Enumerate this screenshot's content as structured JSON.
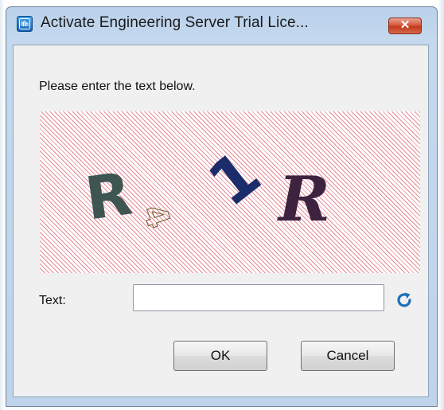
{
  "window": {
    "title": "Activate Engineering Server Trial Lice...",
    "app_icon": "app-icon",
    "close_symbol": "✕"
  },
  "dialog": {
    "prompt": "Please enter the text below.",
    "captcha": {
      "characters": [
        "R",
        "4",
        "1",
        "R"
      ],
      "colors": [
        "#3e5552",
        "#6b5a2a",
        "#1a2d6a",
        "#3d2340"
      ],
      "pattern_color": "#e58a96"
    },
    "text_label": "Text:",
    "text_input": {
      "value": "",
      "placeholder": ""
    },
    "refresh_icon": "refresh-icon",
    "buttons": {
      "ok_label": "OK",
      "cancel_label": "Cancel"
    }
  },
  "colors": {
    "titlebar": "#b9d1ea",
    "client_bg": "#f0f0f0",
    "close_button": "#c4391b",
    "refresh_icon": "#1f6fb5"
  }
}
